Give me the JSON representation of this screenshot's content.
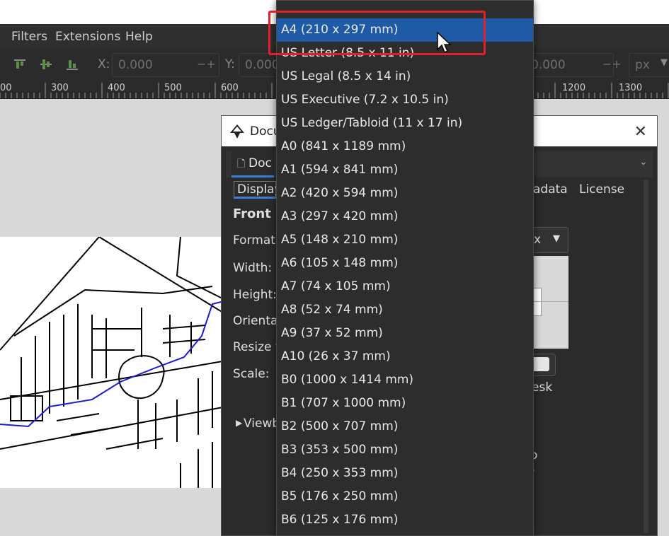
{
  "menubar": {
    "items": [
      "Filters",
      "Extensions",
      "Help"
    ]
  },
  "toolbar": {
    "x_label": "X:",
    "x_value": "0.000",
    "y_label": "Y:",
    "y_value": "0.000",
    "h_value": "0.000",
    "unit": "px",
    "plus_minus": "−+"
  },
  "ruler": {
    "labels": [
      "00",
      "300",
      "400",
      "500",
      "600",
      "1200",
      "1300"
    ]
  },
  "dialog": {
    "title": "Docu",
    "tab_label": "Doc",
    "subtabs": [
      "Display",
      "adata",
      "License"
    ],
    "section_title": "Front p",
    "rows": [
      "Format:",
      "Width:",
      "Height:",
      "Orientat",
      "Resize to",
      "Scale:"
    ],
    "unit_select": "x",
    "desk_label": "esk",
    "viewbox_label": "Viewb",
    "fragments": [
      "o",
      "/"
    ]
  },
  "dropdown": {
    "items": [
      "A4 (210 x 297 mm)",
      "US Letter (8.5 x 11 in)",
      "US Legal (8.5 x 14 in)",
      "US Executive (7.2 x 10.5 in)",
      "US Ledger/Tabloid (11 x 17 in)",
      "A0 (841 x 1189 mm)",
      "A1 (594 x 841 mm)",
      "A2 (420 x 594 mm)",
      "A3 (297 x 420 mm)",
      "A5 (148 x 210 mm)",
      "A6 (105 x 148 mm)",
      "A7 (74 x 105 mm)",
      "A8 (52 x 74 mm)",
      "A9 (37 x 52 mm)",
      "A10 (26 x 37 mm)",
      "B0 (1000 x 1414 mm)",
      "B1 (707 x 1000 mm)",
      "B2 (500 x 707 mm)",
      "B3 (353 x 500 mm)",
      "B4 (250 x 353 mm)",
      "B5 (176 x 250 mm)",
      "B6 (125 x 176 mm)"
    ],
    "selected_index": 0
  },
  "colors": {
    "selection": "#1f5aa6",
    "highlight_box": "#e0202a",
    "route": "#1c1cd0"
  }
}
